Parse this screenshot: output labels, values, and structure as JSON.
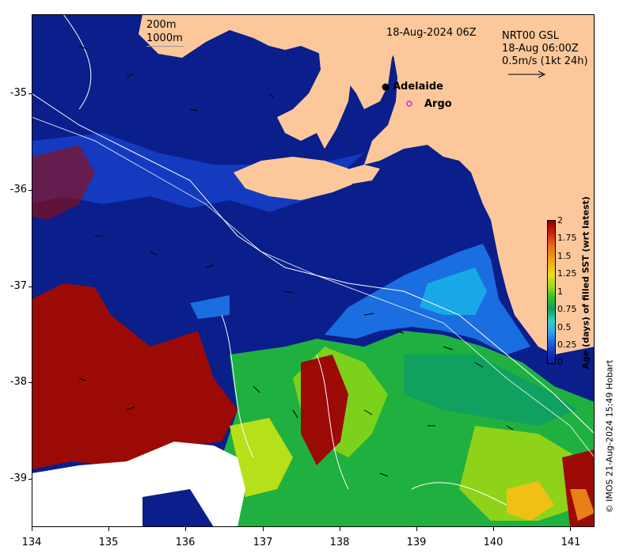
{
  "title": "18-Aug-2024 06Z",
  "product": {
    "line1": "NRT00 GSL",
    "line2": "18-Aug 06:00Z",
    "line3": "0.5m/s (1kt 24h)"
  },
  "bathy_legend": [
    "200m",
    "1000m"
  ],
  "places": [
    {
      "name": "Adelaide",
      "marker": "filled-circle",
      "lon": 138.6,
      "lat": -34.93
    },
    {
      "name": "Argo",
      "marker": "open-circle",
      "lon": 138.82,
      "lat": -35.12
    }
  ],
  "axes": {
    "lon_ticks": [
      "134",
      "135",
      "136",
      "137",
      "138",
      "139",
      "140",
      "141"
    ],
    "lat_ticks": [
      "-35",
      "-36",
      "-37",
      "-38",
      "-39"
    ],
    "lon_range": [
      134,
      141.3
    ],
    "lat_range": [
      -39.5,
      -34.2
    ]
  },
  "colorbar": {
    "title": "Age (days) of filled SST (wrt latest)",
    "labels": [
      "2",
      "1.75",
      "1.5",
      "1.25",
      "1",
      "0.75",
      "0.5",
      "0.25",
      "0"
    ],
    "range": [
      0,
      2
    ]
  },
  "credit": "© IMOS 21-Aug-2024 15:49 Hobart",
  "colors": {
    "land": "#fcc89b",
    "ocean_fresh": "#0a1e8c",
    "no_data": "#ffffff"
  }
}
